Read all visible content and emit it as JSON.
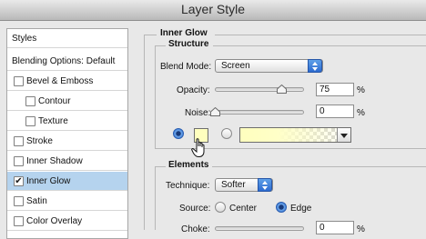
{
  "window": {
    "title": "Layer Style"
  },
  "sidebar": {
    "styles_label": "Styles",
    "blending_label": "Blending Options: Default",
    "items": [
      {
        "label": "Bevel & Emboss",
        "checked": false
      },
      {
        "label": "Contour",
        "checked": false
      },
      {
        "label": "Texture",
        "checked": false
      },
      {
        "label": "Stroke",
        "checked": false
      },
      {
        "label": "Inner Shadow",
        "checked": false
      },
      {
        "label": "Inner Glow",
        "checked": true,
        "selected": true
      },
      {
        "label": "Satin",
        "checked": false
      },
      {
        "label": "Color Overlay",
        "checked": false
      }
    ]
  },
  "inner_glow": {
    "title": "Inner Glow",
    "structure": {
      "title": "Structure",
      "blend_mode_label": "Blend Mode:",
      "blend_mode_value": "Screen",
      "opacity_label": "Opacity:",
      "opacity_value": "75",
      "opacity_unit": "%",
      "opacity_level": 0.75,
      "noise_label": "Noise:",
      "noise_value": "0",
      "noise_unit": "%",
      "noise_level": 0,
      "color_swatch": "#ffffbe"
    },
    "elements": {
      "title": "Elements",
      "technique_label": "Technique:",
      "technique_value": "Softer",
      "source_label": "Source:",
      "source_center_label": "Center",
      "source_edge_label": "Edge",
      "choke_label": "Choke:",
      "choke_value": "0",
      "choke_unit": "%"
    }
  }
}
